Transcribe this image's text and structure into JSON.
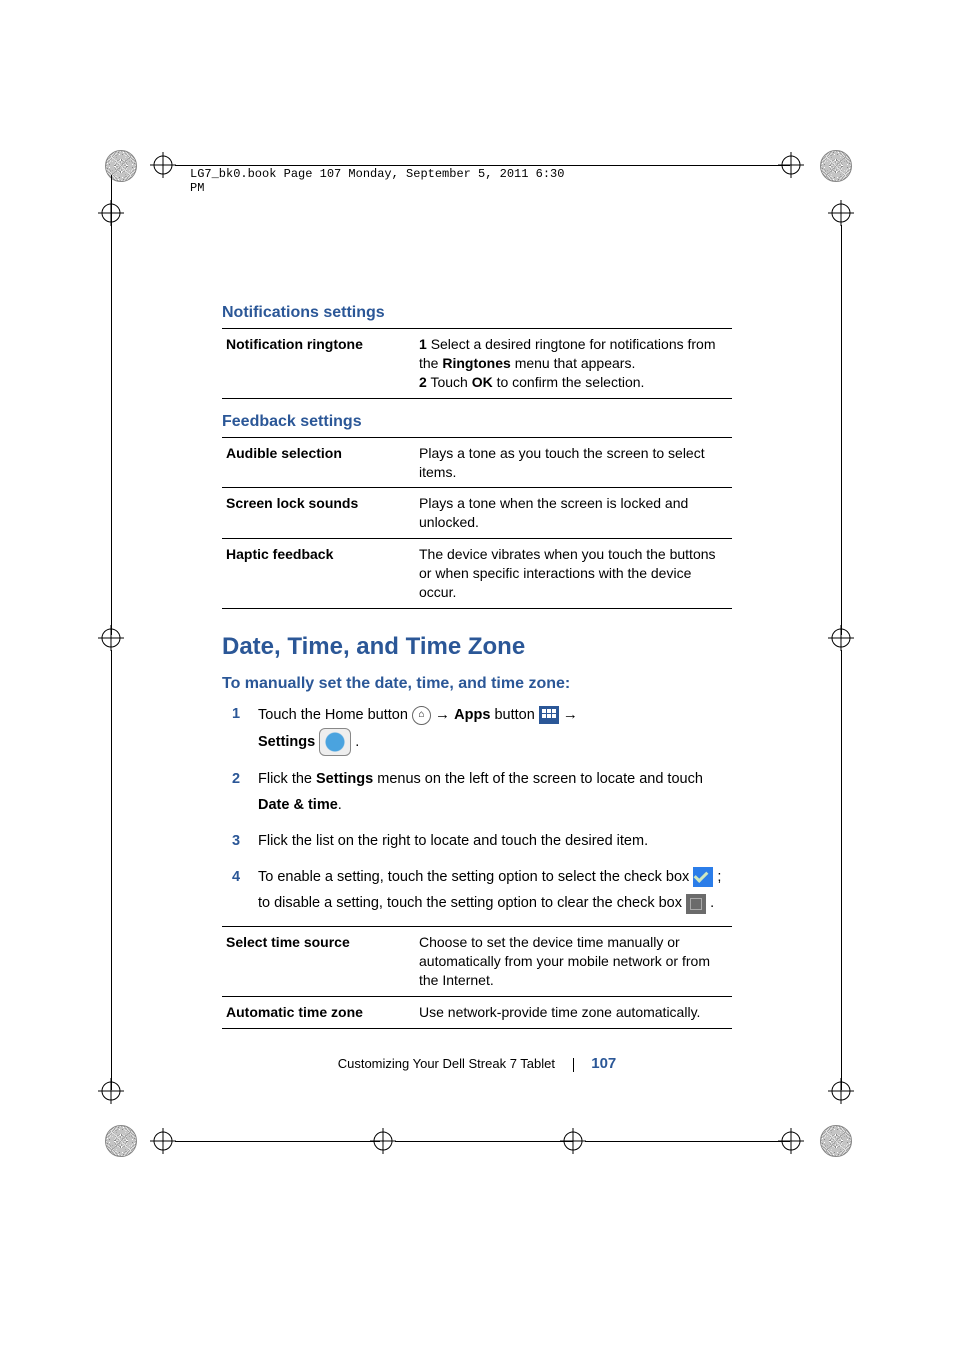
{
  "header": {
    "running_head": "LG7_bk0.book  Page 107  Monday, September 5, 2011  6:30 PM"
  },
  "sections": {
    "notifications": {
      "title": "Notifications settings",
      "row1_label": "Notification ringtone",
      "row1_step1_num": "1",
      "row1_step1_a": "Select a desired ringtone for notifications from the ",
      "row1_step1_bold": "Ringtones",
      "row1_step1_b": " menu that appears.",
      "row1_step2_num": "2",
      "row1_step2_a": "Touch ",
      "row1_step2_bold": "OK",
      "row1_step2_b": " to confirm the selection."
    },
    "feedback": {
      "title": "Feedback settings",
      "r1_label": "Audible selection",
      "r1_desc": "Plays a tone as you touch the screen to select items.",
      "r2_label": "Screen lock sounds",
      "r2_desc": "Plays a tone when the screen is locked and unlocked.",
      "r3_label": "Haptic feedback",
      "r3_desc": "The device vibrates when you touch the buttons or when specific interactions with the device occur."
    },
    "datetime": {
      "heading": "Date, Time, and Time Zone",
      "subheading": "To manually set the date, time, and time zone:",
      "s1_num": "1",
      "s1_a": "Touch the Home button ",
      "s1_b": " → ",
      "s1_apps": "Apps",
      "s1_c": " button ",
      "s1_d": " →",
      "s1_settings": "Settings",
      "s1_end": " .",
      "s2_num": "2",
      "s2_a": "Flick the ",
      "s2_b": "Settings",
      "s2_c": " menus on the left of the screen to locate and touch ",
      "s2_d": "Date & time",
      "s2_e": ".",
      "s3_num": "3",
      "s3_text": "Flick the list on the right to locate and touch the desired item.",
      "s4_num": "4",
      "s4_a": "To enable a setting, touch the setting option to select the check box ",
      "s4_b": " ; to disable a setting, touch the setting option to clear the check box ",
      "s4_c": " .",
      "t1_label": "Select time source",
      "t1_desc": "Choose to set the device time manually or automatically from your mobile network or from the Internet.",
      "t2_label": "Automatic time zone",
      "t2_desc": "Use network-provide time zone automatically."
    }
  },
  "footer": {
    "text": "Customizing Your Dell Streak 7 Tablet",
    "page": "107"
  }
}
